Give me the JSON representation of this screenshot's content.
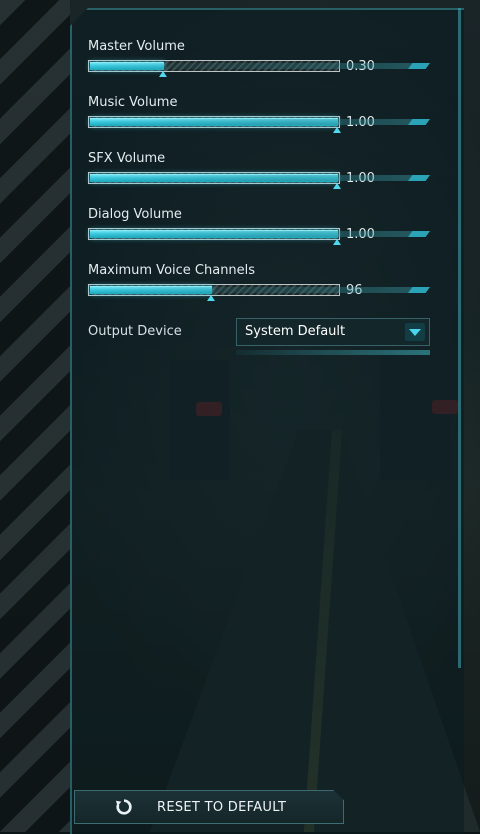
{
  "settings": [
    {
      "label": "Master Volume",
      "value_text": "0.30",
      "level": 0.3
    },
    {
      "label": "Music Volume",
      "value_text": "1.00",
      "level": 1.0
    },
    {
      "label": "SFX Volume",
      "value_text": "1.00",
      "level": 1.0
    },
    {
      "label": "Dialog Volume",
      "value_text": "1.00",
      "level": 1.0
    },
    {
      "label": "Maximum Voice Channels",
      "value_text": "96",
      "level": 0.49
    }
  ],
  "output_device": {
    "label": "Output Device",
    "selected": "System Default"
  },
  "reset": {
    "label": "RESET TO DEFAULT",
    "icon": "reset-icon"
  },
  "colors": {
    "accent": "#3ccbe0",
    "panel_border": "#3c96a0"
  }
}
